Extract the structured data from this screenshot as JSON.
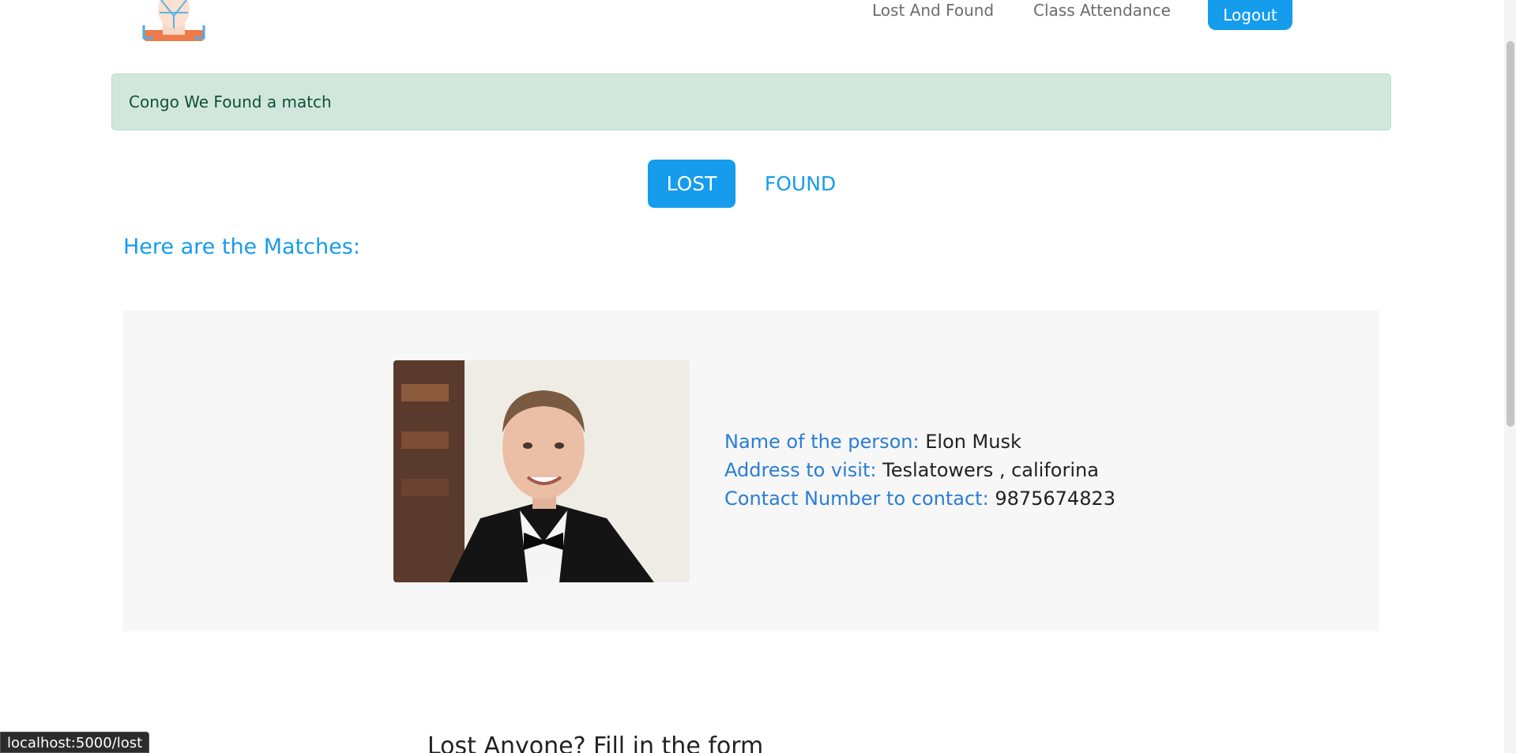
{
  "header": {
    "logo_icon": "face-scan-logo",
    "nav": {
      "lost_and_found": "Lost And Found",
      "class_attendance": "Class Attendance"
    },
    "logout_label": "Logout"
  },
  "alert": {
    "message": "Congo We Found a match"
  },
  "tabs": {
    "lost": "LOST",
    "found": "FOUND"
  },
  "matches": {
    "heading": "Here are the Matches:",
    "items": [
      {
        "photo_icon": "person-photo",
        "name_label": "Name of the person:",
        "name_value": "Elon Musk",
        "address_label": "Address to visit:",
        "address_value": "Teslatowers , califorina",
        "contact_label": "Contact Number to contact:",
        "contact_value": "9875674823"
      }
    ]
  },
  "form": {
    "heading": "Lost Anyone? Fill in the form"
  },
  "status_bar": {
    "url": "localhost:5000/lost"
  },
  "colors": {
    "accent": "#159cec",
    "label": "#2a7dd3",
    "alert_bg": "#d1e7dd",
    "alert_text": "#0f5132",
    "card_bg": "#f7f7f7"
  }
}
